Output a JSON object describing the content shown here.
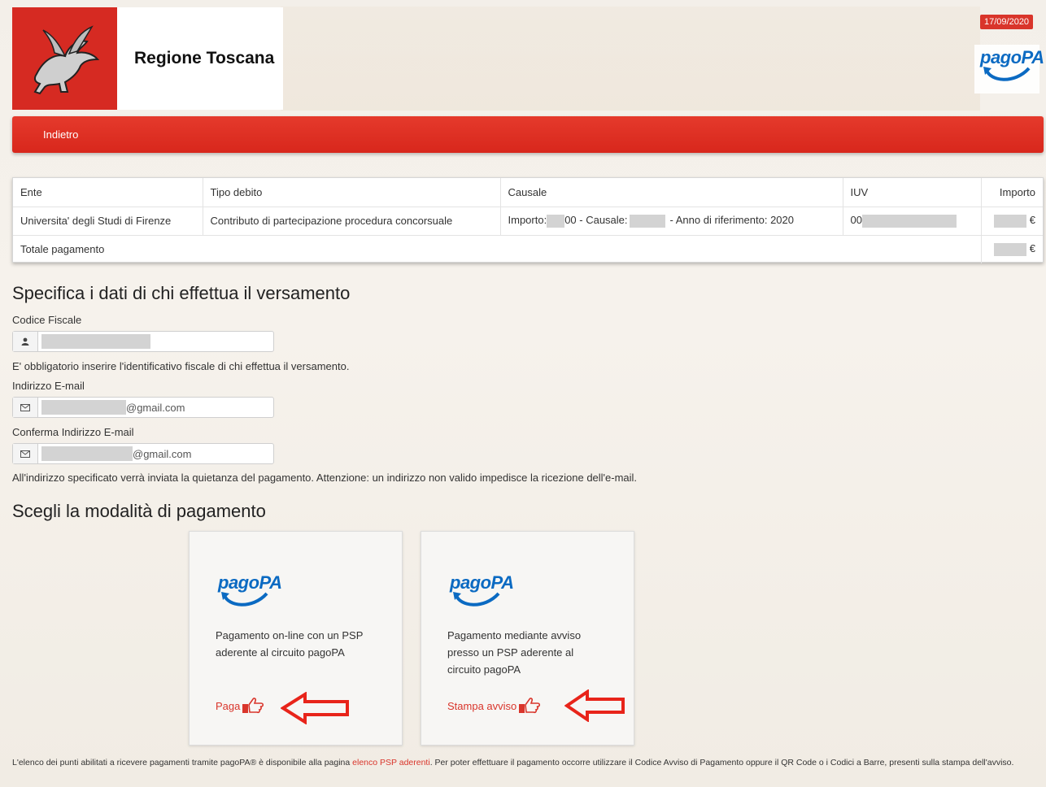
{
  "header": {
    "brand_name": "Regione Toscana",
    "date_badge": "17/09/2020",
    "pagopa_logo_text": "pagoPA"
  },
  "nav": {
    "back_label": "Indietro"
  },
  "debt_table": {
    "headers": [
      "Ente",
      "Tipo debito",
      "Causale",
      "IUV",
      "Importo"
    ],
    "row": {
      "ente": "Universita' degli Studi di Firenze",
      "tipo_debito": "Contributo di partecipazione procedura concorsuale",
      "causale_prefix": "Importo:",
      "causale_mid1": "00 - Causale:",
      "causale_suffix": "- Anno di riferimento: 2020",
      "iuv_prefix": "00",
      "importo_currency": "€"
    },
    "total_label": "Totale pagamento",
    "total_currency": "€"
  },
  "payer_section": {
    "title": "Specifica i dati di chi effettua il versamento",
    "codice_fiscale_label": "Codice Fiscale",
    "codice_fiscale_note": "E' obbligatorio inserire l'identificativo fiscale di chi effettua il versamento.",
    "email_label": "Indirizzo E-mail",
    "email_value_suffix": "@gmail.com",
    "email_confirm_label": "Conferma Indirizzo E-mail",
    "email_confirm_value_suffix": "@gmail.com",
    "email_note": "All'indirizzo specificato verrà inviata la quietanza del pagamento. Attenzione: un indirizzo non valido impedisce la ricezione dell'e-mail."
  },
  "payment_section": {
    "title": "Scegli la modalità di pagamento",
    "cards": [
      {
        "logo": "pagoPA",
        "description": "Pagamento on-line con un PSP aderente al circuito pagoPA",
        "action": "Paga"
      },
      {
        "logo": "pagoPA",
        "description": "Pagamento mediante avviso presso un PSP aderente al circuito pagoPA",
        "action": "Stampa avviso"
      }
    ]
  },
  "footer": {
    "text_before": "L'elenco dei punti abilitati a ricevere pagamenti tramite pagoPA® è disponibile alla pagina ",
    "link": "elenco PSP aderenti",
    "text_after": ". Per poter effettuare il pagamento occorre utilizzare il Codice Avviso di Pagamento oppure il QR Code o i Codici a Barre, presenti sulla stampa dell'avviso."
  },
  "colors": {
    "accent": "#d9352b",
    "pagopa_blue": "#0b6ac2",
    "nav": "#e03a2d"
  },
  "icons": [
    "pegasus-logo",
    "user-icon",
    "envelope-icon",
    "pointing-hand-icon",
    "red-arrow-annotation"
  ]
}
